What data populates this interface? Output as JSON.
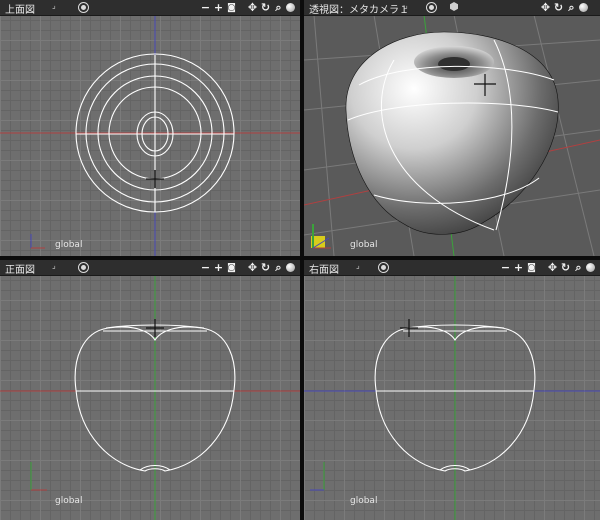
{
  "viewports": {
    "top": {
      "title": "上面図"
    },
    "perspective": {
      "title": "透視図：メタカメラ１"
    },
    "front": {
      "title": "正面図"
    },
    "right": {
      "title": "右面図"
    }
  },
  "header": {
    "arrow": "⌟",
    "tools": {
      "minus": "−",
      "plus": "+",
      "move": "✥",
      "rotate": "↻",
      "zoom": "⌕"
    }
  },
  "coordinate_label": "global",
  "colors": {
    "viewport_bg": "#6e6e6e",
    "axis_x": "#b04040",
    "axis_y": "#3aa33a",
    "axis_z": "#4848b8",
    "wire": "#ffffff"
  }
}
